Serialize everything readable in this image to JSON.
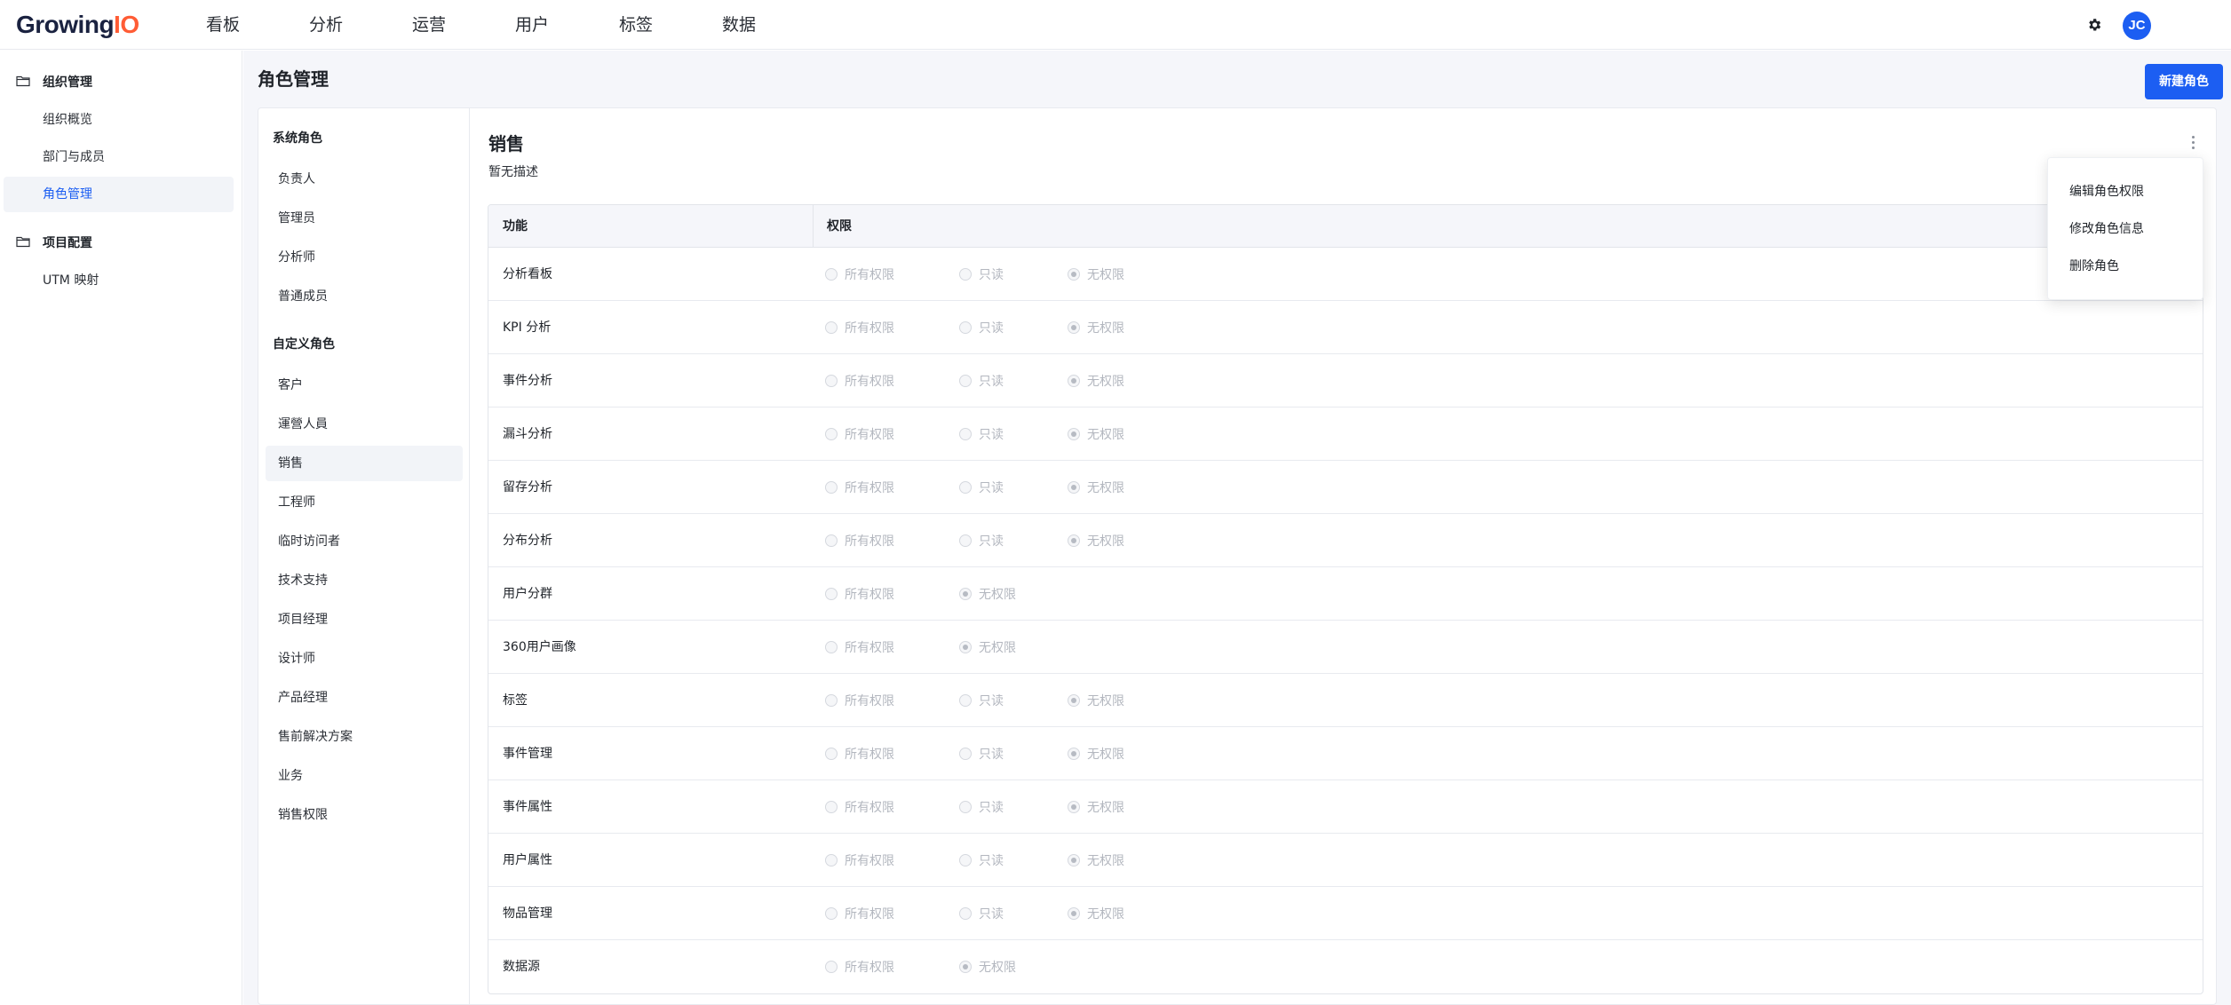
{
  "app": {
    "logo_main": "Growing",
    "logo_accent": "IO"
  },
  "topnav": {
    "items": [
      "看板",
      "分析",
      "运营",
      "用户",
      "标签",
      "数据"
    ],
    "settings_icon": "gear-icon",
    "avatar_initials": "JC",
    "avatar_color": "#1c5ef2"
  },
  "sidebar": {
    "groups": [
      {
        "label": "组织管理",
        "icon": "folder-icon",
        "items": [
          "组织概览",
          "部门与成员",
          "角色管理"
        ]
      },
      {
        "label": "项目配置",
        "icon": "folder-icon",
        "items": [
          "UTM 映射"
        ]
      }
    ],
    "active_item": "角色管理"
  },
  "page": {
    "title": "角色管理",
    "new_button": "新建角色"
  },
  "roles": {
    "system_heading": "系统角色",
    "system": [
      "负责人",
      "管理员",
      "分析师",
      "普通成员"
    ],
    "custom_heading": "自定义角色",
    "custom": [
      "客户",
      "運營人員",
      "销售",
      "工程师",
      "临时访问者",
      "技术支持",
      "项目经理",
      "设计师",
      "产品经理",
      "售前解决方案",
      "业务",
      "销售权限"
    ],
    "active": "销售"
  },
  "detail": {
    "title": "销售",
    "description": "暂无描述",
    "table_headers": [
      "功能",
      "权限"
    ],
    "options": {
      "all": "所有权限",
      "read": "只读",
      "none": "无权限"
    },
    "rows": [
      {
        "name": "分析看板",
        "opts": [
          "all",
          "read",
          "none"
        ],
        "selected": "none"
      },
      {
        "name": "KPI 分析",
        "opts": [
          "all",
          "read",
          "none"
        ],
        "selected": "none"
      },
      {
        "name": "事件分析",
        "opts": [
          "all",
          "read",
          "none"
        ],
        "selected": "none"
      },
      {
        "name": "漏斗分析",
        "opts": [
          "all",
          "read",
          "none"
        ],
        "selected": "none"
      },
      {
        "name": "留存分析",
        "opts": [
          "all",
          "read",
          "none"
        ],
        "selected": "none"
      },
      {
        "name": "分布分析",
        "opts": [
          "all",
          "read",
          "none"
        ],
        "selected": "none"
      },
      {
        "name": "用户分群",
        "opts": [
          "all",
          "none"
        ],
        "selected": "none"
      },
      {
        "name": "360用户画像",
        "opts": [
          "all",
          "none"
        ],
        "selected": "none"
      },
      {
        "name": "标签",
        "opts": [
          "all",
          "read",
          "none"
        ],
        "selected": "none"
      },
      {
        "name": "事件管理",
        "opts": [
          "all",
          "read",
          "none"
        ],
        "selected": "none"
      },
      {
        "name": "事件属性",
        "opts": [
          "all",
          "read",
          "none"
        ],
        "selected": "none"
      },
      {
        "name": "用户属性",
        "opts": [
          "all",
          "read",
          "none"
        ],
        "selected": "none"
      },
      {
        "name": "物品管理",
        "opts": [
          "all",
          "read",
          "none"
        ],
        "selected": "none"
      },
      {
        "name": "数据源",
        "opts": [
          "all",
          "none"
        ],
        "selected": "none"
      }
    ]
  },
  "menu": {
    "items": [
      "编辑角色权限",
      "修改角色信息",
      "删除角色"
    ]
  }
}
